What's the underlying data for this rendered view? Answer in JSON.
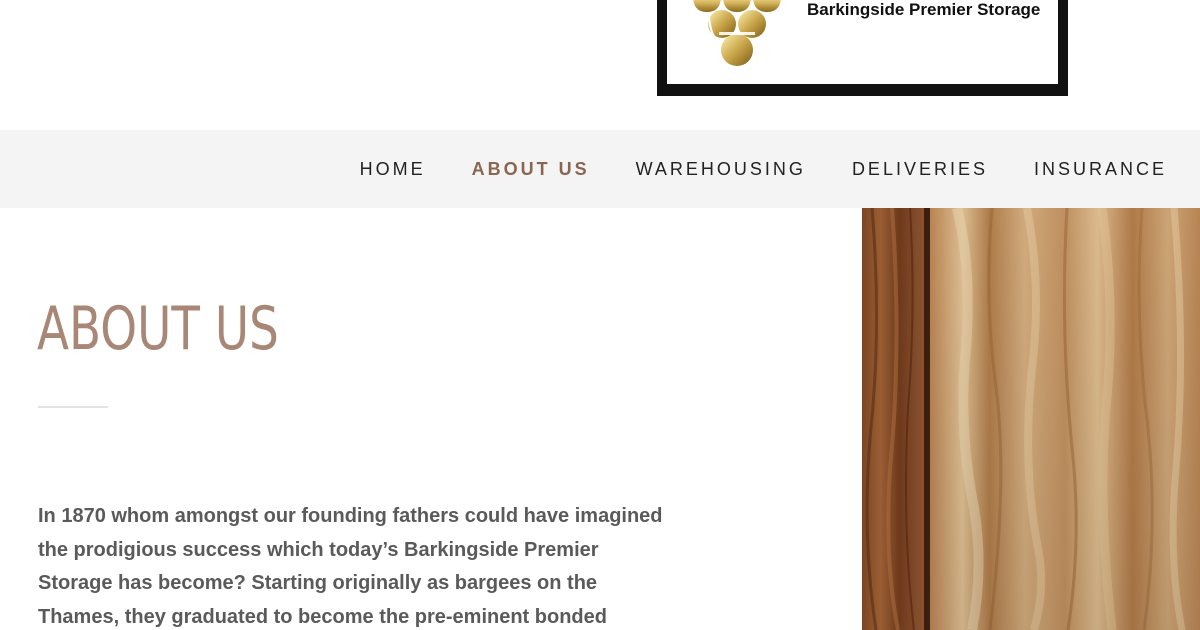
{
  "header": {
    "logo_text": "Barkingside Premier Storage",
    "logo_icon": "grapes-icon"
  },
  "nav": {
    "items": [
      {
        "label": "HOME",
        "active": false
      },
      {
        "label": "ABOUT US",
        "active": true
      },
      {
        "label": "WAREHOUSING",
        "active": false
      },
      {
        "label": "DELIVERIES",
        "active": false
      },
      {
        "label": "INSURANCE",
        "active": false
      }
    ]
  },
  "main": {
    "title": "ABOUT US",
    "intro": "In 1870 whom amongst our founding fathers could have imagined the prodigious success which today’s Barkingside Premier Storage has become? Starting originally as bargees on the Thames, they graduated to become the pre-eminent bonded"
  },
  "colors": {
    "accent": "#a88776",
    "nav_active": "#8a6651",
    "nav_background": "#f4f4f4",
    "body_text": "#5a5a5a"
  }
}
